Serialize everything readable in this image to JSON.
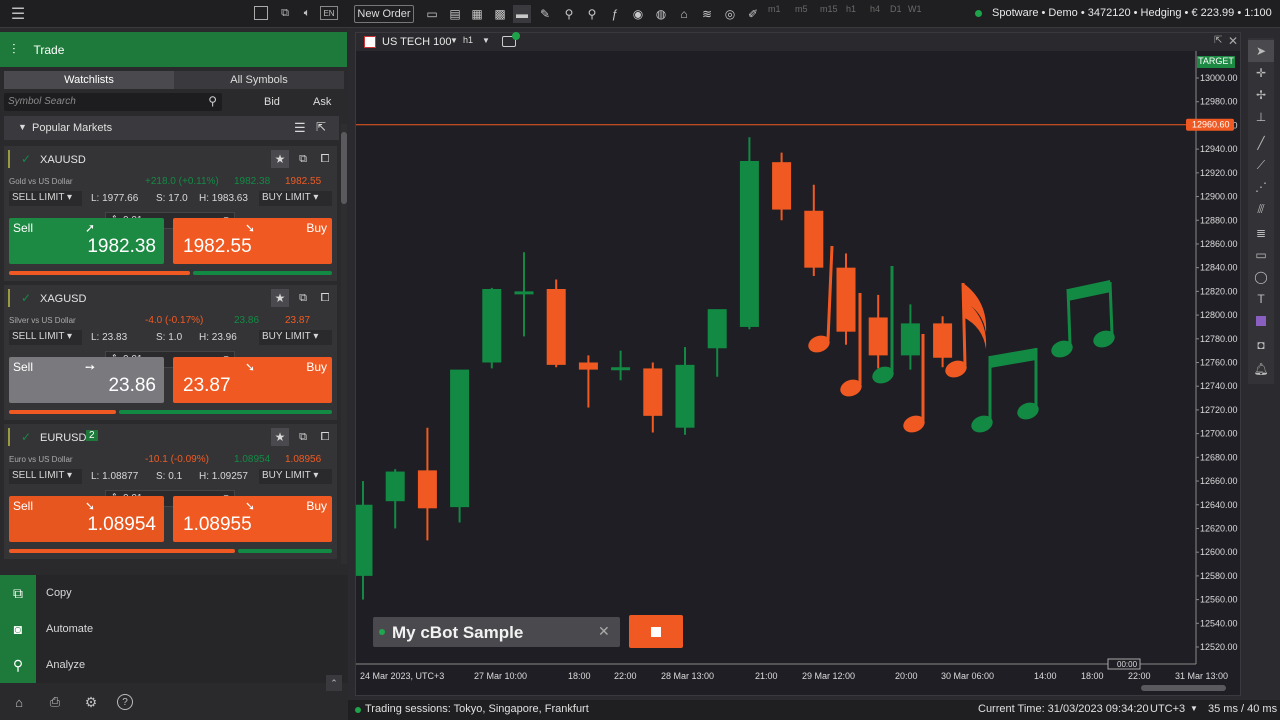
{
  "topbar": {
    "new_order": "New Order",
    "lang": "EN",
    "timeframes": [
      "m1",
      "m5",
      "m15",
      "h1",
      "h4",
      "D1",
      "W1"
    ],
    "account": "Spotware • Demo • 3472120 • Hedging • € 223.99 • 1:100"
  },
  "left": {
    "header": "Trade",
    "tabs": [
      "Watchlists",
      "All Symbols"
    ],
    "search_placeholder": "Symbol Search",
    "bid": "Bid",
    "ask": "Ask",
    "popular": "Popular Markets",
    "cards": [
      {
        "symbol": "XAUUSD",
        "badge": "",
        "desc": "Gold vs US Dollar",
        "change": "+218.0 (+0.11%)",
        "bid": "1982.38",
        "ask": "1982.55",
        "sell_type": "SELL LIMIT",
        "low": "L: 1977.66",
        "spread": "S: 17.0",
        "high": "H: 1983.63",
        "buy_type": "BUY LIMIT",
        "qty": "0.01",
        "sell_label": "Sell",
        "buy_label": "Buy",
        "sell_price": "1982.38",
        "buy_price": "1982.55",
        "sell_color": "#1d8a43",
        "sell_arrow": "➚",
        "sell_ratio": 0.56
      },
      {
        "symbol": "XAGUSD",
        "badge": "",
        "desc": "Silver vs US Dollar",
        "change": "-4.0 (-0.17%)",
        "bid": "23.86",
        "ask": "23.87",
        "sell_type": "SELL LIMIT",
        "low": "L: 23.83",
        "spread": "S: 1.0",
        "high": "H: 23.96",
        "buy_type": "BUY LIMIT",
        "qty": "0.01",
        "sell_label": "Sell",
        "buy_label": "Buy",
        "sell_price": "23.86",
        "buy_price": "23.87",
        "sell_color": "#7a7a7e",
        "sell_arrow": "➙",
        "sell_ratio": 0.33
      },
      {
        "symbol": "EURUSD",
        "badge": "2",
        "desc": "Euro vs US Dollar",
        "change": "-10.1 (-0.09%)",
        "bid": "1.08954",
        "ask": "1.08956",
        "sell_type": "SELL LIMIT",
        "low": "L: 1.08877",
        "spread": "S: 0.1",
        "high": "H: 1.09257",
        "buy_type": "BUY LIMIT",
        "qty": "0.01",
        "sell_label": "Sell",
        "buy_label": "Buy",
        "sell_price": "1.08954",
        "buy_price": "1.08955",
        "sell_color": "#e8561f",
        "sell_arrow": "➘",
        "sell_ratio": 0.7
      }
    ],
    "menu": [
      "Copy",
      "Automate",
      "Analyze"
    ]
  },
  "chart": {
    "symbol": "US TECH 100",
    "timeframe": "h1",
    "target": "TARGET",
    "current_price": "12960.60",
    "cbot_name": "My cBot Sample",
    "time_marker": "00:00",
    "y_labels": [
      "13000.00",
      "12980.00",
      "12960.00",
      "12940.00",
      "12920.00",
      "12900.00",
      "12880.00",
      "12860.00",
      "12840.00",
      "12820.00",
      "12800.00",
      "12780.00",
      "12760.00",
      "12740.00",
      "12720.00",
      "12700.00",
      "12680.00",
      "12660.00",
      "12640.00",
      "12620.00",
      "12600.00",
      "12580.00",
      "12560.00",
      "12540.00",
      "12520.00"
    ],
    "x_labels": [
      "24 Mar 2023, UTC+3",
      "27 Mar 10:00",
      "18:00",
      "22:00",
      "28 Mar 13:00",
      "21:00",
      "29 Mar 12:00",
      "20:00",
      "30 Mar 06:00",
      "14:00",
      "18:00",
      "22:00",
      "31 Mar 13:00"
    ]
  },
  "chart_data": {
    "type": "candlestick",
    "ylim": [
      12510,
      13010
    ],
    "candles": [
      {
        "o": 12580,
        "h": 12660,
        "l": 12560,
        "c": 12640
      },
      {
        "o": 12643,
        "h": 12670,
        "l": 12620,
        "c": 12668
      },
      {
        "o": 12669,
        "h": 12705,
        "l": 12610,
        "c": 12637
      },
      {
        "o": 12638,
        "h": 12745,
        "l": 12625,
        "c": 12754
      },
      {
        "o": 12760,
        "h": 12823,
        "l": 12755,
        "c": 12822
      },
      {
        "o": 12820,
        "h": 12853,
        "l": 12782,
        "c": 12820
      },
      {
        "o": 12822,
        "h": 12830,
        "l": 12756,
        "c": 12758
      },
      {
        "o": 12760,
        "h": 12766,
        "l": 12722,
        "c": 12754
      },
      {
        "o": 12756,
        "h": 12770,
        "l": 12745,
        "c": 12756
      },
      {
        "o": 12755,
        "h": 12760,
        "l": 12701,
        "c": 12715
      },
      {
        "o": 12705,
        "h": 12773,
        "l": 12699,
        "c": 12758
      },
      {
        "o": 12772,
        "h": 12797,
        "l": 12748,
        "c": 12805
      },
      {
        "o": 12790,
        "h": 12950,
        "l": 12788,
        "c": 12930
      },
      {
        "o": 12929,
        "h": 12937,
        "l": 12880,
        "c": 12889
      },
      {
        "o": 12888,
        "h": 12910,
        "l": 12833,
        "c": 12840
      },
      {
        "o": 12840,
        "h": 12852,
        "l": 12775,
        "c": 12786
      },
      {
        "o": 12798,
        "h": 12817,
        "l": 12755,
        "c": 12766
      },
      {
        "o": 12766,
        "h": 12809,
        "l": 12754,
        "c": 12793
      },
      {
        "o": 12793,
        "h": 12799,
        "l": 12756,
        "c": 12764
      }
    ],
    "current_price": 12960.6
  },
  "colors": {
    "up": "#138a44",
    "down": "#f05a22",
    "accent": "#1d7a3a"
  },
  "status": {
    "sessions": "Trading sessions: Tokyo, Singapore, Frankfurt",
    "time": "Current Time: 31/03/2023 09:34:20",
    "tz": "UTC+3",
    "latency": "35 ms / 40 ms"
  }
}
